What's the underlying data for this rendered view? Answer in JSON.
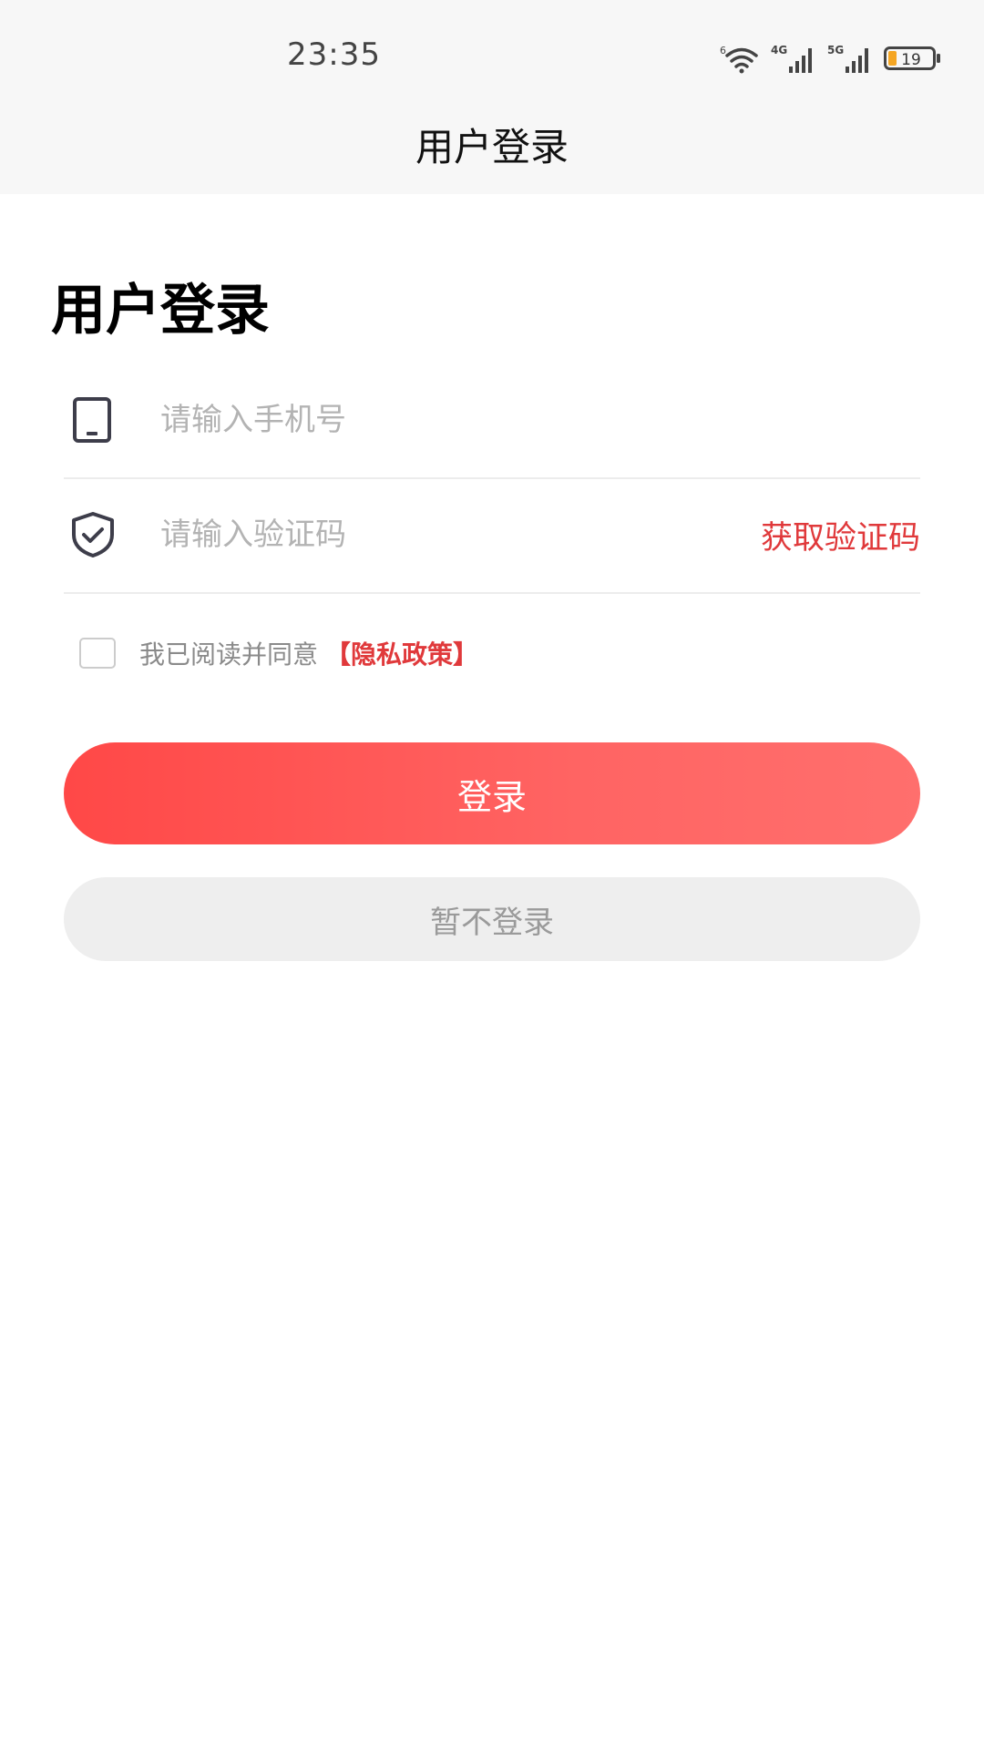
{
  "status_bar": {
    "time": "23:35",
    "wifi_label": "6",
    "signal1_label": "4G",
    "signal2_label": "5G",
    "battery_level": "19",
    "battery_color": "#f5a623"
  },
  "nav": {
    "title": "用户登录"
  },
  "main": {
    "heading": "用户登录",
    "phone": {
      "placeholder": "请输入手机号",
      "icon": "phone-icon"
    },
    "code": {
      "placeholder": "请输入验证码",
      "icon": "shield-check-icon",
      "get_code_label": "获取验证码"
    },
    "agreement": {
      "text": "我已阅读并同意",
      "policy_link": "【隐私政策】",
      "checked": false
    },
    "login_button": "登录",
    "skip_button": "暂不登录"
  },
  "colors": {
    "accent": "#e0393b",
    "button_gradient_start": "#ff4847",
    "button_gradient_end": "#ff6f6d",
    "topbar_bg": "#f7f7f7"
  }
}
